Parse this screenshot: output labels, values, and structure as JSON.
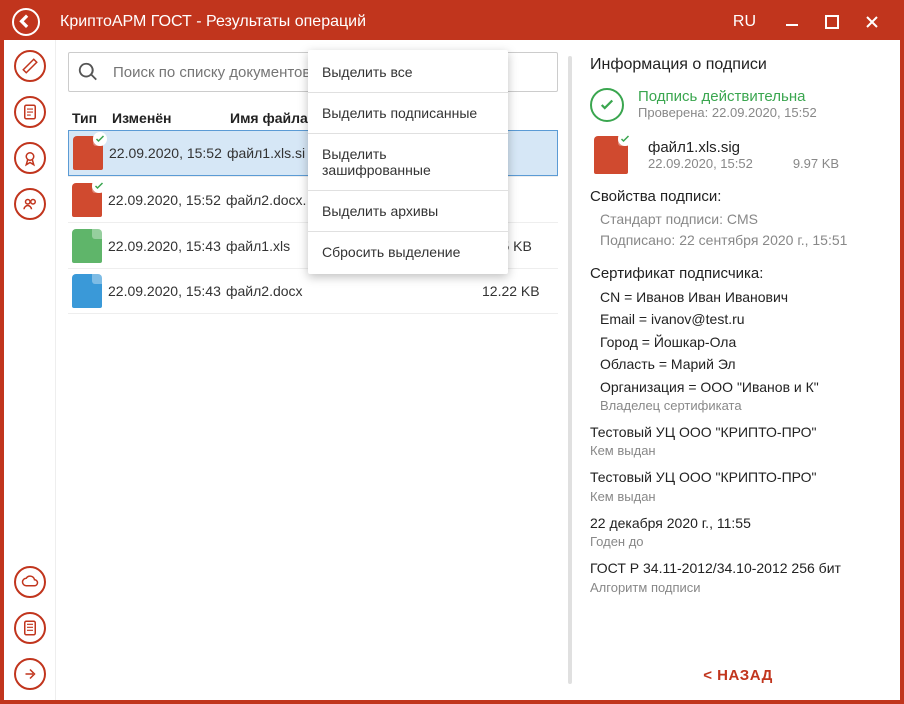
{
  "titlebar": {
    "title": "КриптоАРМ ГОСТ - Результаты операций",
    "lang": "RU"
  },
  "search": {
    "placeholder": "Поиск по списку документов"
  },
  "table": {
    "headers": {
      "type": "Тип",
      "date": "Изменён",
      "name": "Имя файла",
      "size": ""
    },
    "rows": [
      {
        "date": "22.09.2020, 15:52",
        "name": "файл1.xls.si",
        "size": "",
        "icon": "sig",
        "badge": true
      },
      {
        "date": "22.09.2020, 15:52",
        "name": "файл2.docx.",
        "size": "",
        "icon": "sig",
        "badge": true
      },
      {
        "date": "22.09.2020, 15:43",
        "name": "файл1.xls",
        "size": "7.75 KB",
        "icon": "xls",
        "badge": false
      },
      {
        "date": "22.09.2020, 15:43",
        "name": "файл2.docx",
        "size": "12.22 KB",
        "icon": "docx",
        "badge": false
      }
    ]
  },
  "menu": {
    "select_all": "Выделить все",
    "select_signed": "Выделить подписанные",
    "select_encrypted": "Выделить зашифрованные",
    "select_archives": "Выделить архивы",
    "clear": "Сбросить выделение"
  },
  "info": {
    "title": "Информация о подписи",
    "valid": "Подпись действительна",
    "checked": "Проверена: 22.09.2020, 15:52",
    "file": {
      "name": "файл1.xls.sig",
      "date": "22.09.2020, 15:52",
      "size": "9.97 KB"
    },
    "props_title": "Свойства подписи:",
    "std": "Стандарт подписи: CMS",
    "signed": "Подписано: 22 сентября 2020 г., 15:51",
    "cert_title": "Сертификат подписчика:",
    "cn": "CN = Иванов Иван Иванович",
    "email": "Email = ivanov@test.ru",
    "city": "Город = Йошкар-Ола",
    "region": "Область = Марий Эл",
    "org": "Организация = ООО \"Иванов и К\"",
    "owner": "Владелец сертификата",
    "ca1": "Тестовый УЦ ООО \"КРИПТО-ПРО\"",
    "issued1": "Кем выдан",
    "ca2": "Тестовый УЦ ООО \"КРИПТО-ПРО\"",
    "issued2": "Кем выдан",
    "valid_until": "22 декабря 2020 г., 11:55",
    "valid_label": "Годен до",
    "alg": "ГОСТ Р 34.11-2012/34.10-2012 256 бит",
    "alg_label": "Алгоритм подписи",
    "back": "< НАЗАД"
  }
}
